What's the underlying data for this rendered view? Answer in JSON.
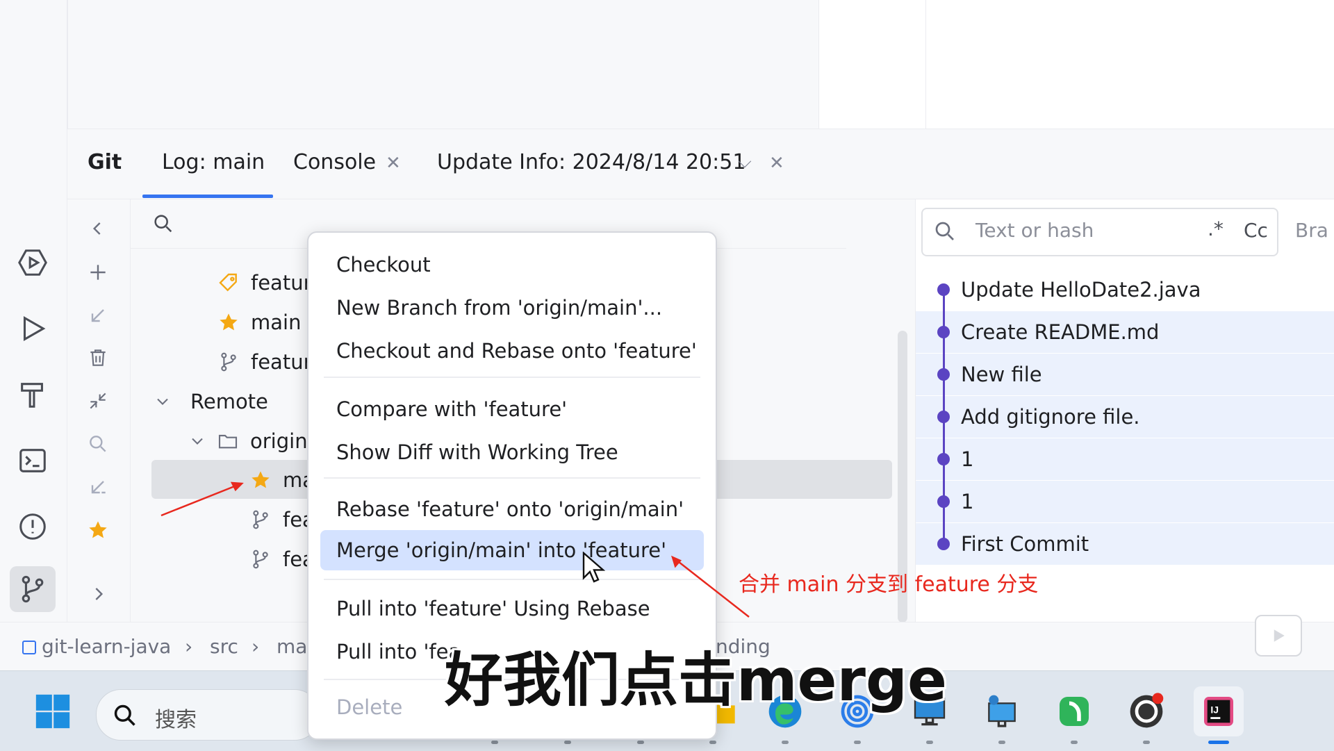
{
  "tabs": {
    "git": "Git",
    "log": "Log: main",
    "console": "Console",
    "update_info": "Update Info: 2024/8/14 20:51"
  },
  "branch_tree": {
    "items": [
      {
        "label": "featur",
        "icon": "tag-icon"
      },
      {
        "label": "main",
        "icon": "star-icon"
      },
      {
        "label": "featur",
        "icon": "branch-icon"
      },
      {
        "label": "Remote",
        "icon": "chevron-down-icon"
      },
      {
        "label": "origin",
        "icon": "folder-icon"
      },
      {
        "label": "ma",
        "icon": "star-icon"
      },
      {
        "label": "fea",
        "icon": "branch-icon"
      },
      {
        "label": "fea",
        "icon": "branch-icon"
      }
    ]
  },
  "log_search": {
    "placeholder": "Text or hash",
    "regex": ".*",
    "case": "Cc",
    "branch_filter": "Bra"
  },
  "commits": [
    {
      "message": "Update HelloDate2.java",
      "highlighted": false
    },
    {
      "message": "Create README.md",
      "highlighted": true
    },
    {
      "message": "New file",
      "highlighted": true
    },
    {
      "message": "Add gitignore file.",
      "highlighted": true
    },
    {
      "message": "1",
      "highlighted": true
    },
    {
      "message": "1",
      "highlighted": true
    },
    {
      "message": "First Commit",
      "highlighted": true
    }
  ],
  "context_menu": {
    "checkout": "Checkout",
    "new_branch": "New Branch from 'origin/main'...",
    "checkout_rebase": "Checkout and Rebase onto 'feature'",
    "compare": "Compare with 'feature'",
    "show_diff": "Show Diff with Working Tree",
    "rebase": "Rebase 'feature' onto 'origin/main'",
    "merge": "Merge 'origin/main' into 'feature'",
    "pull_rebase": "Pull into 'feature' Using Rebase",
    "pull_merge": "Pull into 'fea",
    "delete": "Delete"
  },
  "breadcrumb": {
    "project": "git-learn-java",
    "src": "src",
    "ma": "ma",
    "tail": "nding"
  },
  "taskbar": {
    "search_placeholder": "搜索"
  },
  "annotation": "合并 main 分支到 feature 分支",
  "subtitle": "好我们点击merge",
  "colors": {
    "accent": "#3574f0",
    "commit_dot": "#5b44c2",
    "annotation_red": "#e8281e",
    "menu_selected": "#d4e2ff"
  }
}
